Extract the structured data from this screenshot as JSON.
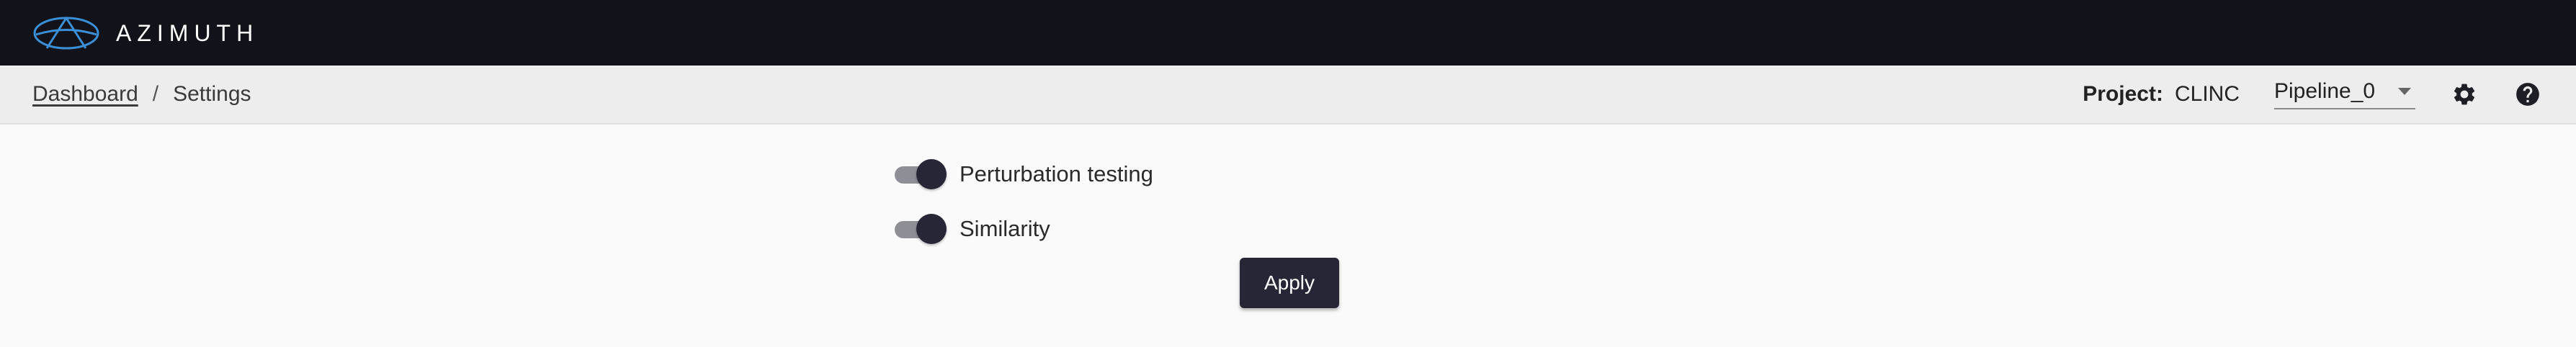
{
  "app": {
    "brand_name": "AZIMUTH",
    "colors": {
      "topbar_bg": "#12131a",
      "logo_accent": "#3b8fd6",
      "primary": "#262637",
      "subbar_bg": "#ededed"
    }
  },
  "breadcrumb": {
    "items": [
      "Dashboard",
      "Settings"
    ],
    "separator": "/"
  },
  "header": {
    "project_label": "Project:",
    "project_value": "CLINC",
    "pipeline_value": "Pipeline_0",
    "settings_icon": "gear-icon",
    "help_icon": "help-circle-icon"
  },
  "settings": {
    "toggles": [
      {
        "label": "Perturbation testing",
        "checked": true
      },
      {
        "label": "Similarity",
        "checked": true
      }
    ],
    "apply_label": "Apply"
  }
}
